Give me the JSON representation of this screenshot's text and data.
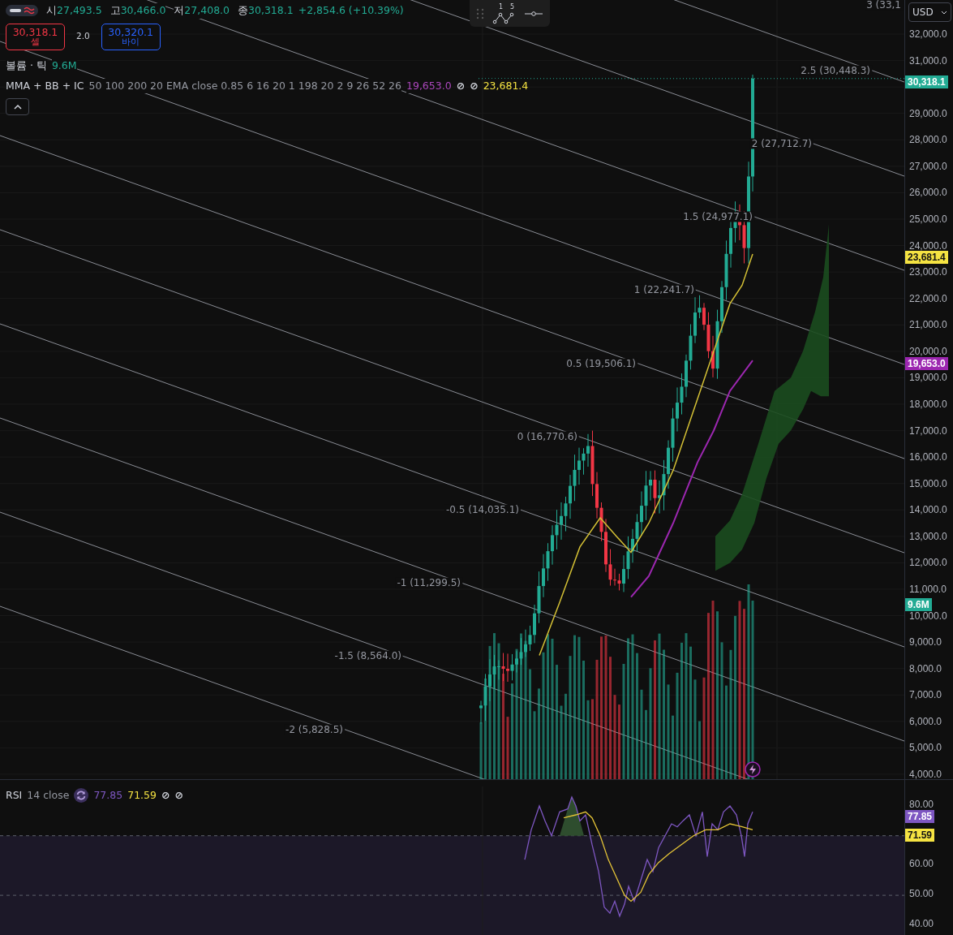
{
  "legend": {
    "ohlc": [
      {
        "label": "시",
        "value": "27,493.5"
      },
      {
        "label": "고",
        "value": "30,466.0"
      },
      {
        "label": "저",
        "value": "27,408.0"
      },
      {
        "label": "종",
        "value": "30,318.1"
      }
    ],
    "change": "+2,854.6 (+10.39%)"
  },
  "trade": {
    "sell": {
      "price": "30,318.1",
      "label": "셀"
    },
    "spread": "2.0",
    "buy": {
      "price": "30,320.1",
      "label": "바이"
    }
  },
  "volume_legend": {
    "title": "볼륨 · 틱",
    "value": "9.6M"
  },
  "indicator": {
    "name": "MMA + BB + IC",
    "params": "50 100 200 20 EMA close 0.85 6 16 20 1 198 20 2 9 26 52 26",
    "values": [
      {
        "kind": "value",
        "text": "19,653.0",
        "color": "#ab47bc"
      },
      {
        "kind": "hidden",
        "text": "⊘"
      },
      {
        "kind": "hidden",
        "text": "⊘"
      },
      {
        "kind": "value",
        "text": "23,681.4",
        "color": "#f5e342"
      }
    ]
  },
  "toolbar": {
    "wave_labels": [
      "1",
      "5"
    ]
  },
  "fib_levels": [
    "-2 (5,828.5)",
    "-1.5 (8,564.0)",
    "-1 (11,299.5)",
    "-0.5 (14,035.1)",
    "0 (16,770.6)",
    "0.5 (19,506.1)",
    "1 (22,241.7)",
    "1.5 (24,977.1)",
    "2 (27,712.7)",
    "2.5 (30,448.3)",
    "3 (33,1"
  ],
  "price_axis": {
    "currency": "USD",
    "ticks": [
      "32,000.0",
      "31,000.0",
      "29,000.0",
      "28,000.0",
      "27,000.0",
      "26,000.0",
      "25,000.0",
      "24,000.0",
      "23,000.0",
      "22,000.0",
      "21,000.0",
      "20,000.0",
      "19,000.0",
      "18,000.0",
      "17,000.0",
      "16,000.0",
      "15,000.0",
      "14,000.0",
      "13,000.0",
      "12,000.0",
      "11,000.0",
      "10,000.0",
      "9,000.0",
      "8,000.0",
      "7,000.0",
      "6,000.0",
      "5,000.0",
      "4,000.0"
    ],
    "tags": [
      {
        "kind": "price",
        "text": "30,318.1",
        "color": "#22ab94"
      },
      {
        "kind": "price",
        "text": "23,681.4",
        "color": "#f5e342"
      },
      {
        "kind": "price",
        "text": "19,653.0",
        "color": "#9c27b0"
      },
      {
        "kind": "volume",
        "text": "9.6M",
        "color": "#22ab94"
      }
    ]
  },
  "rsi": {
    "title": "RSI",
    "params": "14 close",
    "values": [
      {
        "text": "77.85",
        "color": "#7e57c2"
      },
      {
        "text": "71.59",
        "color": "#f5e342"
      }
    ],
    "hidden": [
      "⊘",
      "⊘"
    ]
  },
  "rsi_axis": {
    "ticks": [
      "80.00",
      "60.00",
      "50.00",
      "40.00"
    ],
    "tags": [
      {
        "text": "77.85",
        "color": "#7e57c2"
      },
      {
        "text": "71.59",
        "color": "#f5e342"
      }
    ]
  }
}
